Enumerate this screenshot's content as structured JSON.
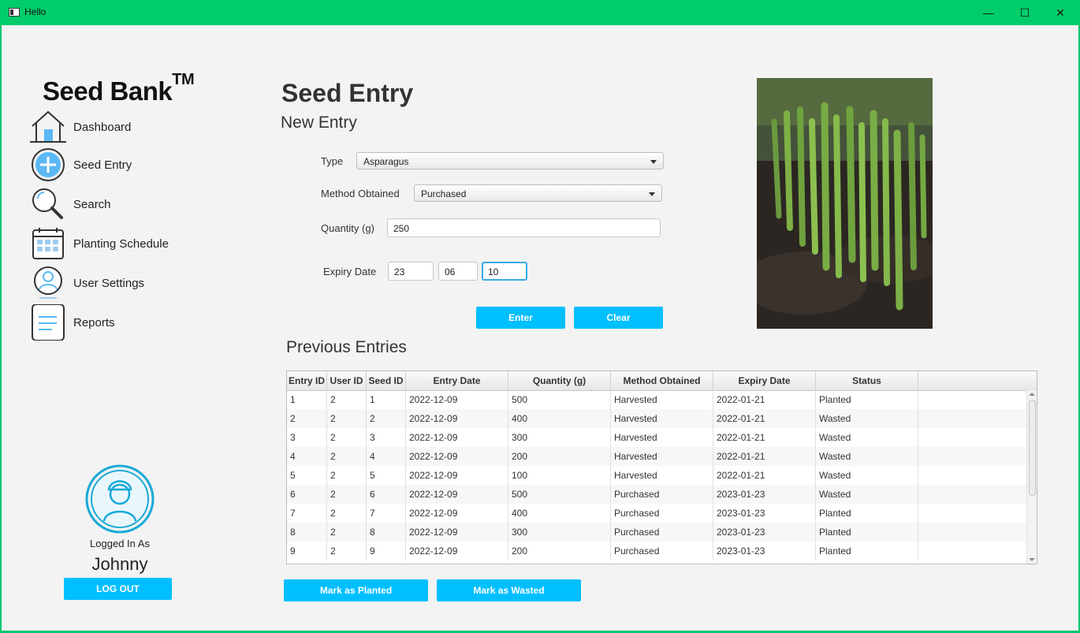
{
  "window": {
    "title": "Hello",
    "minimize": "—",
    "maximize": "☐",
    "close": "✕"
  },
  "brand": {
    "name": "Seed Bank",
    "tm": "TM"
  },
  "nav": [
    {
      "label": "Dashboard",
      "icon": "house-icon"
    },
    {
      "label": "Seed Entry",
      "icon": "plus-circle-icon"
    },
    {
      "label": "Search",
      "icon": "magnifier-icon"
    },
    {
      "label": "Planting Schedule",
      "icon": "calendar-icon"
    },
    {
      "label": "User Settings",
      "icon": "user-circle-icon"
    },
    {
      "label": "Reports",
      "icon": "document-icon"
    }
  ],
  "user": {
    "logged_in_label": "Logged In As",
    "name": "Johnny",
    "logout": "LOG OUT"
  },
  "page": {
    "title": "Seed Entry"
  },
  "new_entry": {
    "heading": "New Entry",
    "type_label": "Type",
    "type_value": "Asparagus",
    "method_label": "Method Obtained",
    "method_value": "Purchased",
    "quantity_label": "Quantity (g)",
    "quantity_value": "250",
    "expiry_label": "Expiry Date",
    "expiry_day": "23",
    "expiry_month": "06",
    "expiry_year": "10",
    "enter": "Enter",
    "clear": "Clear"
  },
  "previous": {
    "heading": "Previous Entries",
    "columns": [
      "Entry ID",
      "User ID",
      "Seed ID",
      "Entry Date",
      "Quantity (g)",
      "Method Obtained",
      "Expiry Date",
      "Status"
    ],
    "rows": [
      [
        "1",
        "2",
        "1",
        "2022-12-09",
        "500",
        "Harvested",
        "2022-01-21",
        "Planted"
      ],
      [
        "2",
        "2",
        "2",
        "2022-12-09",
        "400",
        "Harvested",
        "2022-01-21",
        "Wasted"
      ],
      [
        "3",
        "2",
        "3",
        "2022-12-09",
        "300",
        "Harvested",
        "2022-01-21",
        "Wasted"
      ],
      [
        "4",
        "2",
        "4",
        "2022-12-09",
        "200",
        "Harvested",
        "2022-01-21",
        "Wasted"
      ],
      [
        "5",
        "2",
        "5",
        "2022-12-09",
        "100",
        "Harvested",
        "2022-01-21",
        "Wasted"
      ],
      [
        "6",
        "2",
        "6",
        "2022-12-09",
        "500",
        "Purchased",
        "2023-01-23",
        "Wasted"
      ],
      [
        "7",
        "2",
        "7",
        "2022-12-09",
        "400",
        "Purchased",
        "2023-01-23",
        "Planted"
      ],
      [
        "8",
        "2",
        "8",
        "2022-12-09",
        "300",
        "Purchased",
        "2023-01-23",
        "Planted"
      ],
      [
        "9",
        "2",
        "9",
        "2022-12-09",
        "200",
        "Purchased",
        "2023-01-23",
        "Planted"
      ]
    ],
    "mark_planted": "Mark as Planted",
    "mark_wasted": "Mark as Wasted"
  },
  "colors": {
    "titlebar": "#00cc6a",
    "accent": "#00bfff",
    "focus": "#39a9e6"
  }
}
